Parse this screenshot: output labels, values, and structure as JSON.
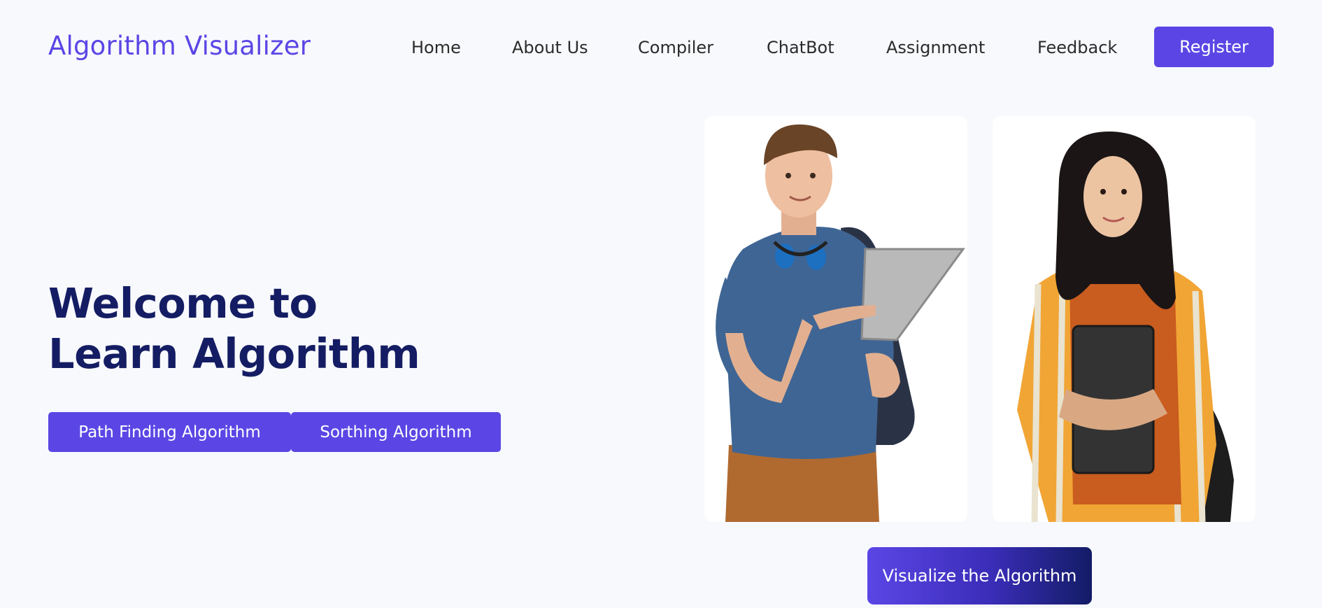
{
  "header": {
    "brand": "Algorithm Visualizer",
    "nav": {
      "home": "Home",
      "about": "About Us",
      "compiler": "Compiler",
      "chatbot": "ChatBot",
      "assignment": "Assignment",
      "feedback": "Feedback"
    },
    "register_label": "Register"
  },
  "hero": {
    "title_line1": "Welcome to",
    "title_line2": "Learn Algorithm",
    "buttons": {
      "path_finding": "Path Finding Algorithm",
      "sorting": "Sorthing Algorithm"
    },
    "cta_label": "Visualize the Algorithm"
  },
  "colors": {
    "accent": "#5b46e5",
    "title": "#141d63",
    "background": "#f8f9fd"
  },
  "images": [
    {
      "name": "student-man-with-tablet-photo"
    },
    {
      "name": "student-woman-with-notebook-photo"
    }
  ]
}
